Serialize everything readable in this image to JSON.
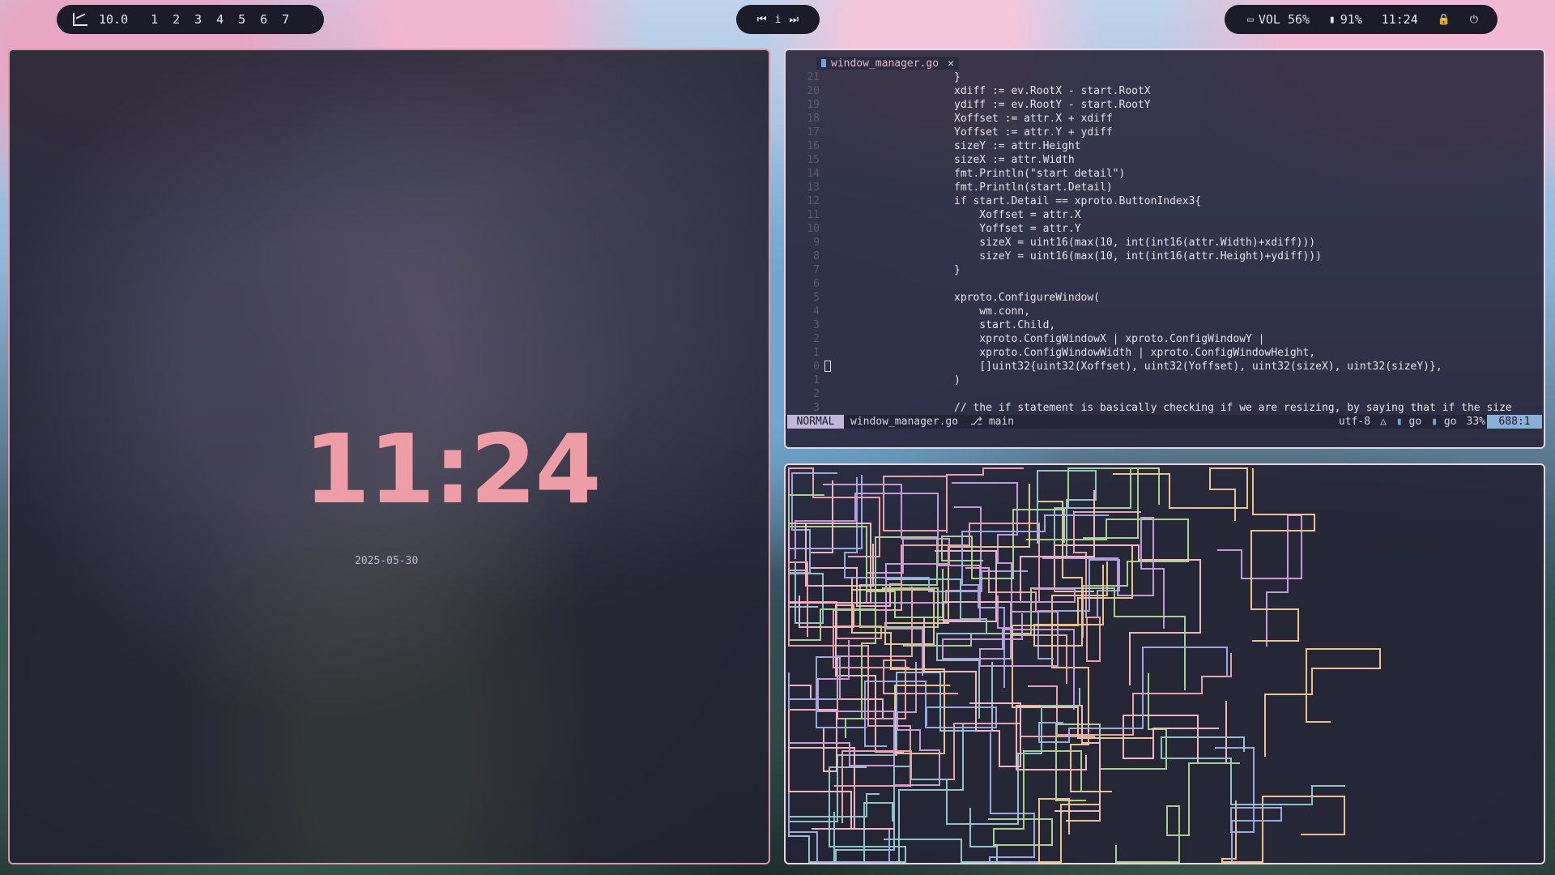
{
  "topbar": {
    "left": {
      "graph_icon": "chart-line-icon",
      "load": "10.0",
      "workspaces": [
        "1",
        "2",
        "3",
        "4",
        "5",
        "6",
        "7"
      ]
    },
    "center": {
      "prev": "⏮",
      "info": "i",
      "next": "⏭"
    },
    "right": {
      "keyboard_icon": "keyboard-icon",
      "volume": "VOL 56%",
      "battery": "91%",
      "time": "11:24",
      "lock_icon": "lock-icon",
      "power_icon": "power-icon"
    }
  },
  "clock": {
    "time": "11:24",
    "date": "2025-05-30",
    "color": "#ec9da5"
  },
  "editor": {
    "tab": {
      "filename": "window_manager.go",
      "close": "✕"
    },
    "lines": [
      {
        "n": "21",
        "code": "}"
      },
      {
        "n": "20",
        "code": "xdiff := ev.RootX - start.RootX"
      },
      {
        "n": "19",
        "code": "ydiff := ev.RootY - start.RootY"
      },
      {
        "n": "18",
        "code": "Xoffset := attr.X + xdiff"
      },
      {
        "n": "17",
        "code": "Yoffset := attr.Y + ydiff"
      },
      {
        "n": "16",
        "code": "sizeY := attr.Height"
      },
      {
        "n": "15",
        "code": "sizeX := attr.Width"
      },
      {
        "n": "14",
        "code": "fmt.Println(\"start detail\")"
      },
      {
        "n": "13",
        "code": "fmt.Println(start.Detail)"
      },
      {
        "n": "12",
        "code": "if start.Detail == xproto.ButtonIndex3{"
      },
      {
        "n": "11",
        "code": "    Xoffset = attr.X"
      },
      {
        "n": "10",
        "code": "    Yoffset = attr.Y"
      },
      {
        "n": "9",
        "code": "    sizeX = uint16(max(10, int(int16(attr.Width)+xdiff)))"
      },
      {
        "n": "8",
        "code": "    sizeY = uint16(max(10, int(int16(attr.Height)+ydiff)))"
      },
      {
        "n": "7",
        "code": "}"
      },
      {
        "n": "6",
        "code": ""
      },
      {
        "n": "5",
        "code": "xproto.ConfigureWindow("
      },
      {
        "n": "4",
        "code": "    wm.conn,"
      },
      {
        "n": "3",
        "code": "    start.Child,"
      },
      {
        "n": "2",
        "code": "    xproto.ConfigWindowX | xproto.ConfigWindowY |"
      },
      {
        "n": "1",
        "code": "    xproto.ConfigWindowWidth | xproto.ConfigWindowHeight,"
      },
      {
        "n": "0",
        "code": "    []uint32{uint32(Xoffset), uint32(Yoffset), uint32(sizeX), uint32(sizeY)},"
      },
      {
        "n": "1",
        "code": ")"
      },
      {
        "n": "2",
        "code": ""
      },
      {
        "n": "3",
        "code": "// the if statement is basically checking if we are resizing, by saying that if the size"
      }
    ],
    "status": {
      "mode": "NORMAL",
      "file": "window_manager.go",
      "branch": "main",
      "encoding": "utf-8",
      "filetype": "go",
      "percent": "33%",
      "position": "688:1"
    }
  },
  "pipes": {
    "colors": [
      "#e8a0aa",
      "#a8d08d",
      "#8fc3c9",
      "#9ba7e0",
      "#e8c48c",
      "#c59ad6",
      "#f0b6c2"
    ]
  }
}
